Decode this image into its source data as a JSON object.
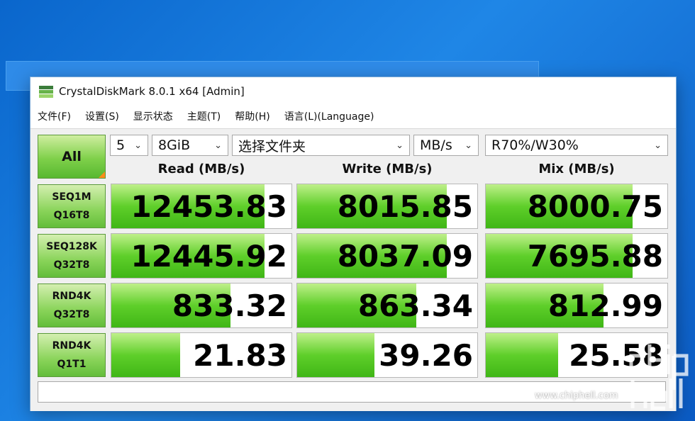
{
  "window": {
    "title": "CrystalDiskMark 8.0.1 x64 [Admin]",
    "menu": [
      "文件(F)",
      "设置(S)",
      "显示状态",
      "主题(T)",
      "帮助(H)",
      "语言(L)(Language)"
    ]
  },
  "controls": {
    "all_label": "All",
    "count": "5",
    "size": "8GiB",
    "folder": "选择文件夹",
    "unit": "MB/s",
    "mix_ratio": "R70%/W30%"
  },
  "headers": {
    "read": "Read (MB/s)",
    "write": "Write (MB/s)",
    "mix": "Mix (MB/s)"
  },
  "rows": [
    {
      "line1": "SEQ1M",
      "line2": "Q16T8",
      "read": "12453.83",
      "write": "8015.85",
      "mix": "8000.75",
      "read_fill": 0.85,
      "write_fill": 0.83,
      "mix_fill": 0.81
    },
    {
      "line1": "SEQ128K",
      "line2": "Q32T8",
      "read": "12445.92",
      "write": "8037.09",
      "mix": "7695.88",
      "read_fill": 0.85,
      "write_fill": 0.83,
      "mix_fill": 0.81
    },
    {
      "line1": "RND4K",
      "line2": "Q32T8",
      "read": "833.32",
      "write": "863.34",
      "mix": "812.99",
      "read_fill": 0.66,
      "write_fill": 0.66,
      "mix_fill": 0.65
    },
    {
      "line1": "RND4K",
      "line2": "Q1T1",
      "read": "21.83",
      "write": "39.26",
      "mix": "25.58",
      "read_fill": 0.38,
      "write_fill": 0.43,
      "mix_fill": 0.4
    }
  ],
  "watermark": {
    "url": "www.chiphell.com",
    "logo_text": "chip hell"
  },
  "colors": {
    "accent_green": "#5fcf2a",
    "desktop_blue": "#0a66cc",
    "all_corner": "#ff8c1a"
  }
}
